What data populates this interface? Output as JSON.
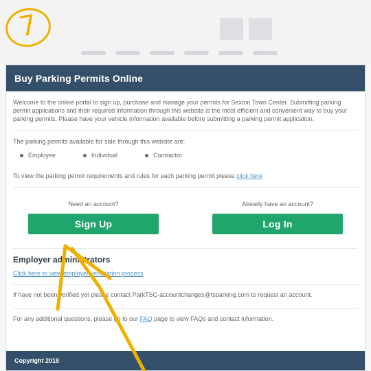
{
  "annotation": {
    "step_number": "7"
  },
  "panel": {
    "title": "Buy Parking Permits Online",
    "intro_text": "Welcome to the online portal to sign up, purchase and manage your permits for Sexton Town Center. Submitting parking permit applications and their required information through this website is the most efficient and convenient way to buy your parking permits. Please have your vehicle information available before submitting a parking permit application.",
    "available_text": "The parking permits available for sale through this website are:",
    "permit_types": [
      "Employee",
      "Individual",
      "Contractor"
    ],
    "requirements_text": "To view the parking permit requirements and rules for each parking permit please ",
    "requirements_link": "click here",
    "signup_prompt": "Need an account?",
    "signup_button": "Sign Up",
    "login_prompt": "Already have an account?",
    "login_button": "Log In",
    "employer_heading": "Employer administrators",
    "employer_link": "Click here to view employer verification process",
    "employer_note": "If have not been verified yet please contact ParkTSC-accountchanges@tsparking.com to request an account.",
    "questions_prefix": "For any additional questions, please go to our ",
    "questions_link": "FAQ",
    "questions_suffix": " page to view FAQs and contact information.",
    "footer": "Copyright 2018"
  },
  "colors": {
    "header": "#334f69",
    "button": "#20a56c",
    "annotation": "#f0b000",
    "link": "#4d93c8"
  }
}
